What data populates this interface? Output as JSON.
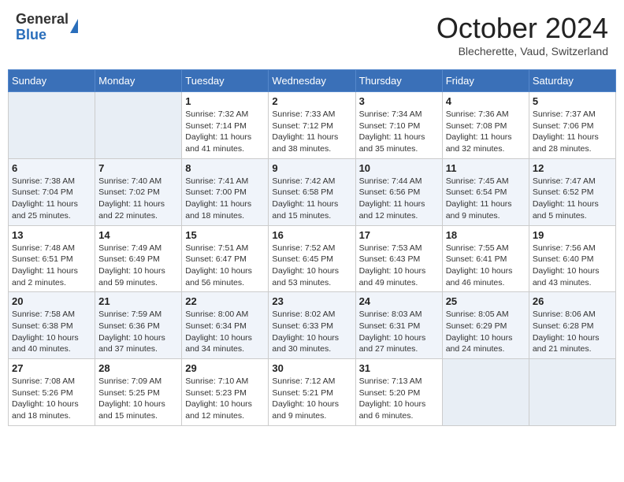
{
  "header": {
    "logo_general": "General",
    "logo_blue": "Blue",
    "month_title": "October 2024",
    "location": "Blecherette, Vaud, Switzerland"
  },
  "days_of_week": [
    "Sunday",
    "Monday",
    "Tuesday",
    "Wednesday",
    "Thursday",
    "Friday",
    "Saturday"
  ],
  "weeks": [
    [
      {
        "day": "",
        "info": ""
      },
      {
        "day": "",
        "info": ""
      },
      {
        "day": "1",
        "info": "Sunrise: 7:32 AM\nSunset: 7:14 PM\nDaylight: 11 hours and 41 minutes."
      },
      {
        "day": "2",
        "info": "Sunrise: 7:33 AM\nSunset: 7:12 PM\nDaylight: 11 hours and 38 minutes."
      },
      {
        "day": "3",
        "info": "Sunrise: 7:34 AM\nSunset: 7:10 PM\nDaylight: 11 hours and 35 minutes."
      },
      {
        "day": "4",
        "info": "Sunrise: 7:36 AM\nSunset: 7:08 PM\nDaylight: 11 hours and 32 minutes."
      },
      {
        "day": "5",
        "info": "Sunrise: 7:37 AM\nSunset: 7:06 PM\nDaylight: 11 hours and 28 minutes."
      }
    ],
    [
      {
        "day": "6",
        "info": "Sunrise: 7:38 AM\nSunset: 7:04 PM\nDaylight: 11 hours and 25 minutes."
      },
      {
        "day": "7",
        "info": "Sunrise: 7:40 AM\nSunset: 7:02 PM\nDaylight: 11 hours and 22 minutes."
      },
      {
        "day": "8",
        "info": "Sunrise: 7:41 AM\nSunset: 7:00 PM\nDaylight: 11 hours and 18 minutes."
      },
      {
        "day": "9",
        "info": "Sunrise: 7:42 AM\nSunset: 6:58 PM\nDaylight: 11 hours and 15 minutes."
      },
      {
        "day": "10",
        "info": "Sunrise: 7:44 AM\nSunset: 6:56 PM\nDaylight: 11 hours and 12 minutes."
      },
      {
        "day": "11",
        "info": "Sunrise: 7:45 AM\nSunset: 6:54 PM\nDaylight: 11 hours and 9 minutes."
      },
      {
        "day": "12",
        "info": "Sunrise: 7:47 AM\nSunset: 6:52 PM\nDaylight: 11 hours and 5 minutes."
      }
    ],
    [
      {
        "day": "13",
        "info": "Sunrise: 7:48 AM\nSunset: 6:51 PM\nDaylight: 11 hours and 2 minutes."
      },
      {
        "day": "14",
        "info": "Sunrise: 7:49 AM\nSunset: 6:49 PM\nDaylight: 10 hours and 59 minutes."
      },
      {
        "day": "15",
        "info": "Sunrise: 7:51 AM\nSunset: 6:47 PM\nDaylight: 10 hours and 56 minutes."
      },
      {
        "day": "16",
        "info": "Sunrise: 7:52 AM\nSunset: 6:45 PM\nDaylight: 10 hours and 53 minutes."
      },
      {
        "day": "17",
        "info": "Sunrise: 7:53 AM\nSunset: 6:43 PM\nDaylight: 10 hours and 49 minutes."
      },
      {
        "day": "18",
        "info": "Sunrise: 7:55 AM\nSunset: 6:41 PM\nDaylight: 10 hours and 46 minutes."
      },
      {
        "day": "19",
        "info": "Sunrise: 7:56 AM\nSunset: 6:40 PM\nDaylight: 10 hours and 43 minutes."
      }
    ],
    [
      {
        "day": "20",
        "info": "Sunrise: 7:58 AM\nSunset: 6:38 PM\nDaylight: 10 hours and 40 minutes."
      },
      {
        "day": "21",
        "info": "Sunrise: 7:59 AM\nSunset: 6:36 PM\nDaylight: 10 hours and 37 minutes."
      },
      {
        "day": "22",
        "info": "Sunrise: 8:00 AM\nSunset: 6:34 PM\nDaylight: 10 hours and 34 minutes."
      },
      {
        "day": "23",
        "info": "Sunrise: 8:02 AM\nSunset: 6:33 PM\nDaylight: 10 hours and 30 minutes."
      },
      {
        "day": "24",
        "info": "Sunrise: 8:03 AM\nSunset: 6:31 PM\nDaylight: 10 hours and 27 minutes."
      },
      {
        "day": "25",
        "info": "Sunrise: 8:05 AM\nSunset: 6:29 PM\nDaylight: 10 hours and 24 minutes."
      },
      {
        "day": "26",
        "info": "Sunrise: 8:06 AM\nSunset: 6:28 PM\nDaylight: 10 hours and 21 minutes."
      }
    ],
    [
      {
        "day": "27",
        "info": "Sunrise: 7:08 AM\nSunset: 5:26 PM\nDaylight: 10 hours and 18 minutes."
      },
      {
        "day": "28",
        "info": "Sunrise: 7:09 AM\nSunset: 5:25 PM\nDaylight: 10 hours and 15 minutes."
      },
      {
        "day": "29",
        "info": "Sunrise: 7:10 AM\nSunset: 5:23 PM\nDaylight: 10 hours and 12 minutes."
      },
      {
        "day": "30",
        "info": "Sunrise: 7:12 AM\nSunset: 5:21 PM\nDaylight: 10 hours and 9 minutes."
      },
      {
        "day": "31",
        "info": "Sunrise: 7:13 AM\nSunset: 5:20 PM\nDaylight: 10 hours and 6 minutes."
      },
      {
        "day": "",
        "info": ""
      },
      {
        "day": "",
        "info": ""
      }
    ]
  ]
}
